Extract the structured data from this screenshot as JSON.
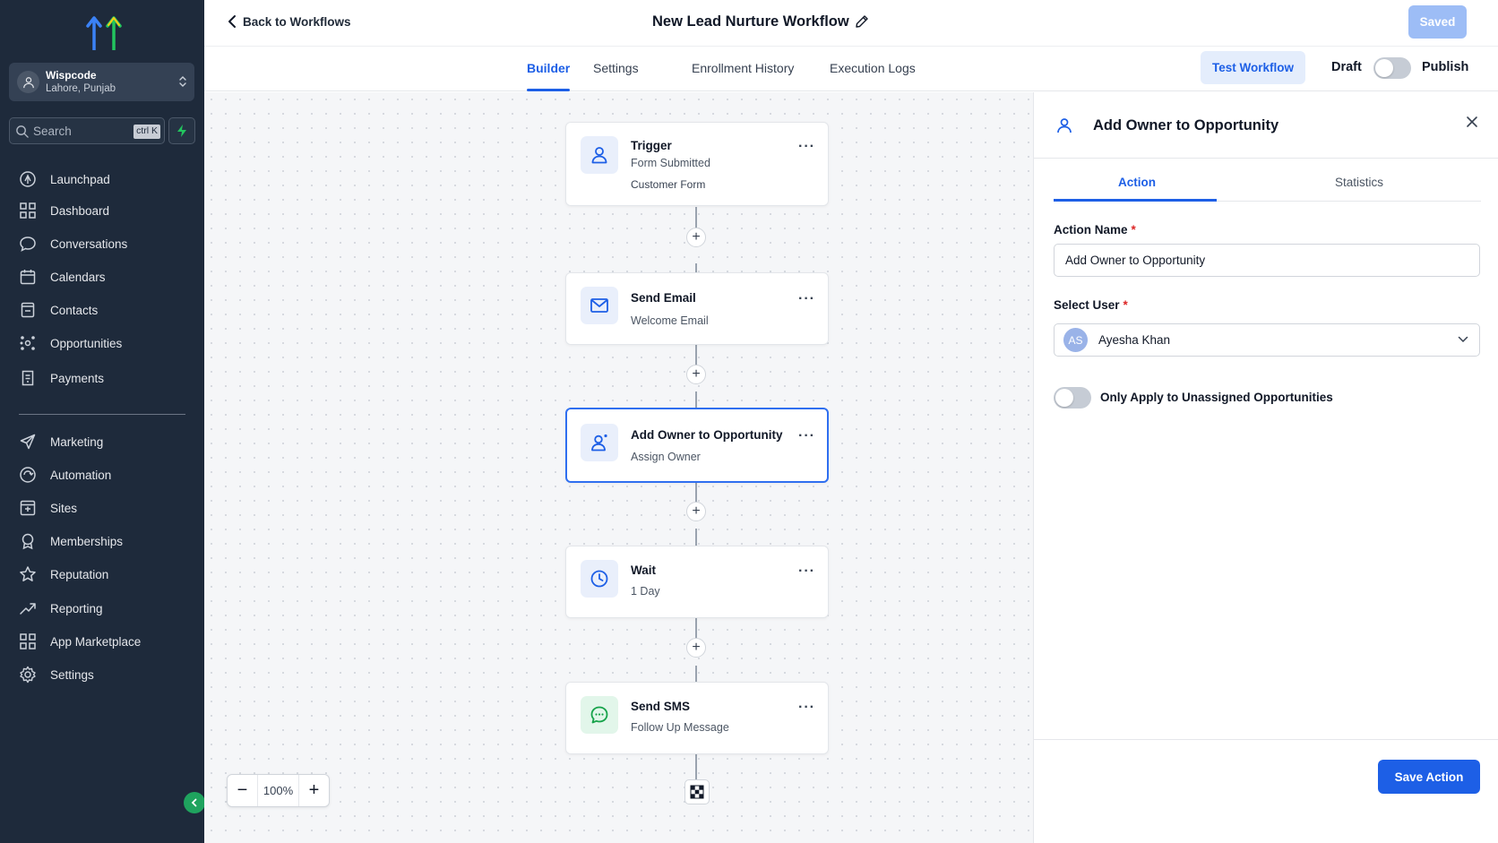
{
  "sidebar": {
    "account": {
      "name": "Wispcode",
      "location": "Lahore, Punjab"
    },
    "search": {
      "placeholder": "Search",
      "shortcut": "ctrl K"
    },
    "items": [
      {
        "label": "Launchpad",
        "icon": "rocket-icon"
      },
      {
        "label": "Dashboard",
        "icon": "grid-icon"
      },
      {
        "label": "Conversations",
        "icon": "chat-icon"
      },
      {
        "label": "Calendars",
        "icon": "calendar-icon"
      },
      {
        "label": "Contacts",
        "icon": "contact-book-icon"
      },
      {
        "label": "Opportunities",
        "icon": "hub-icon"
      },
      {
        "label": "Payments",
        "icon": "receipt-icon"
      },
      {
        "label": "Marketing",
        "icon": "send-icon"
      },
      {
        "label": "Automation",
        "icon": "automation-icon"
      },
      {
        "label": "Sites",
        "icon": "sites-icon"
      },
      {
        "label": "Memberships",
        "icon": "award-icon"
      },
      {
        "label": "Reputation",
        "icon": "star-icon"
      },
      {
        "label": "Reporting",
        "icon": "trend-icon"
      },
      {
        "label": "App Marketplace",
        "icon": "apps-icon"
      },
      {
        "label": "Settings",
        "icon": "gear-icon"
      }
    ]
  },
  "topbar": {
    "back_label": "Back to Workflows",
    "workflow_title": "New Lead Nurture Workflow",
    "saved_label": "Saved"
  },
  "tabs": {
    "items": [
      "Builder",
      "Settings",
      "Enrollment History",
      "Execution Logs"
    ],
    "active": "Builder",
    "test_label": "Test Workflow",
    "draft_label": "Draft",
    "publish_label": "Publish"
  },
  "canvas": {
    "zoom": "100%",
    "nodes": [
      {
        "title": "Trigger",
        "subtitle": "Form Submitted",
        "detail": "Customer Form",
        "icon": "user-icon"
      },
      {
        "title": "Send Email",
        "subtitle": "Welcome Email",
        "icon": "mail-icon"
      },
      {
        "title": "Add Owner to Opportunity",
        "subtitle": "Assign Owner",
        "icon": "user-add-icon",
        "selected": true
      },
      {
        "title": "Wait",
        "subtitle": "1 Day",
        "icon": "clock-icon"
      },
      {
        "title": "Send SMS",
        "subtitle": "Follow Up Message",
        "icon": "sms-icon"
      }
    ]
  },
  "panel": {
    "title": "Add Owner to Opportunity",
    "tabs": [
      "Action",
      "Statistics"
    ],
    "active_tab": "Action",
    "action_name_label": "Action Name",
    "required_mark": "*",
    "action_name_value": "Add Owner to Opportunity",
    "select_user_label": "Select User",
    "selected_user": {
      "initials": "AS",
      "name": "Ayesha Khan"
    },
    "apply_label": "Only Apply to Unassigned Opportunities",
    "apply_enabled": false,
    "save_label": "Save Action"
  },
  "colors": {
    "sidebar_bg": "#1e2a3b",
    "accent": "#1d5fe6",
    "saved_button": "#9dbdf6",
    "collapse_button": "#1fa35e"
  }
}
